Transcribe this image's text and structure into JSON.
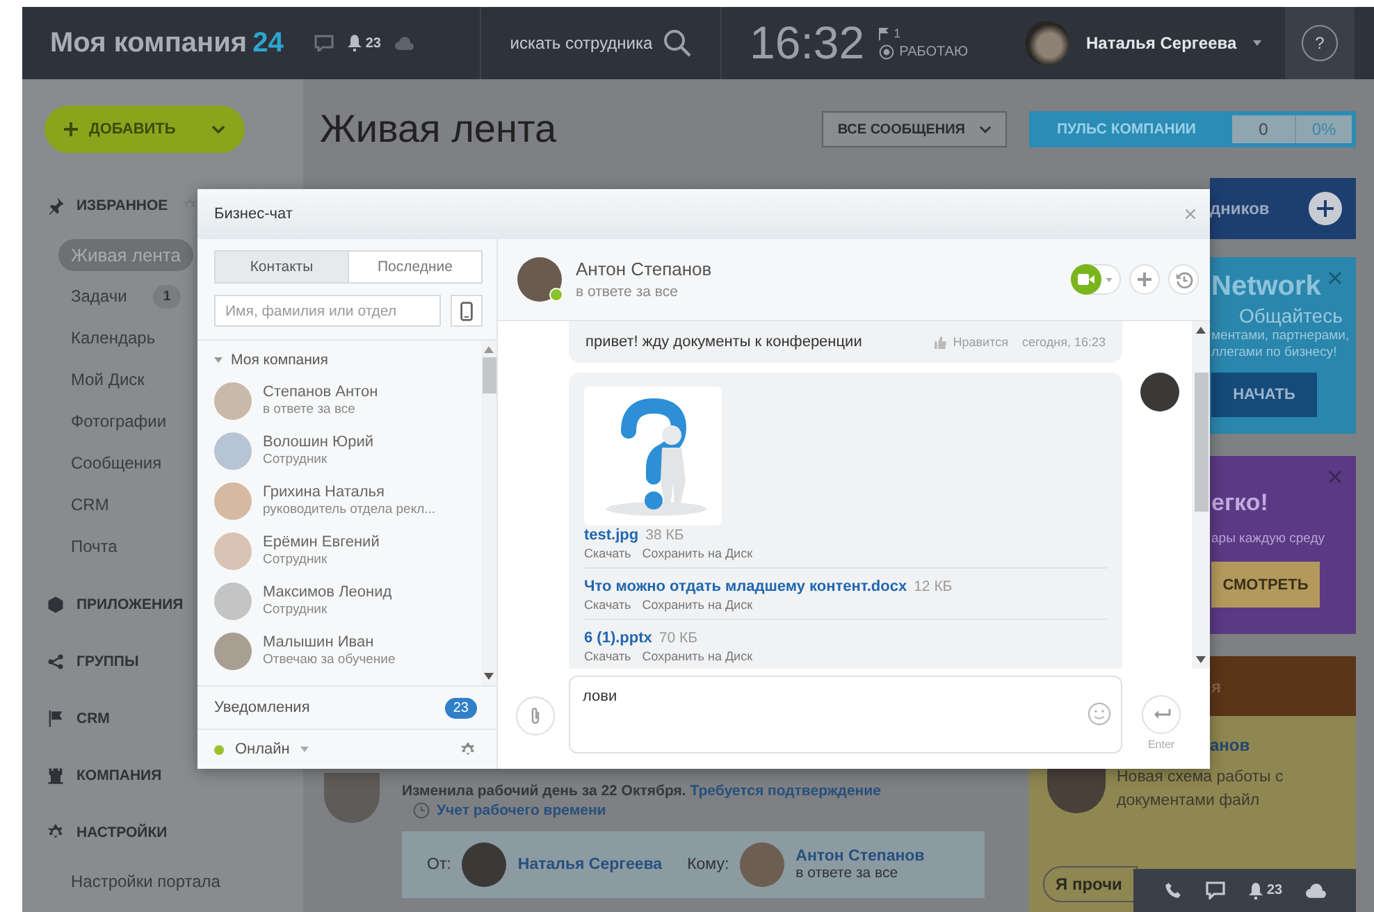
{
  "top_bar": {
    "company": "Моя компания",
    "company_suffix": "24",
    "notifications": "23",
    "search_label": "искать сотрудника",
    "time": "16:32",
    "flag_count": "1",
    "work_status": "РАБОТАЮ",
    "user_name": "Наталья Сергеева",
    "help": "?"
  },
  "add_button": "ДОБАВИТЬ",
  "sidebar": [
    {
      "kind": "section",
      "label": "ИЗБРАННОЕ"
    },
    {
      "kind": "link",
      "label": "Живая лента",
      "selected": true
    },
    {
      "kind": "link",
      "label": "Задачи",
      "selected": false,
      "badge": "1"
    },
    {
      "kind": "link",
      "label": "Календарь",
      "selected": false
    },
    {
      "kind": "link",
      "label": "Мой Диск",
      "selected": false
    },
    {
      "kind": "link",
      "label": "Фотографии",
      "selected": false
    },
    {
      "kind": "link",
      "label": "Сообщения",
      "selected": false
    },
    {
      "kind": "link",
      "label": "CRM",
      "selected": false
    },
    {
      "kind": "link",
      "label": "Почта",
      "selected": false
    },
    {
      "kind": "section",
      "label": "ПРИЛОЖЕНИЯ"
    },
    {
      "kind": "section",
      "label": "ГРУППЫ"
    },
    {
      "kind": "section",
      "label": "CRM"
    },
    {
      "kind": "section",
      "label": "КОМПАНИЯ"
    },
    {
      "kind": "section",
      "label": "НАСТРОЙКИ"
    },
    {
      "kind": "link",
      "label": "Настройки портала",
      "selected": false
    }
  ],
  "page_title": "Живая лента",
  "filter_button": "ВСЕ СООБЩЕНИЯ",
  "pulse": {
    "label": "ПУЛЬС КОМПАНИИ",
    "count": "0",
    "percent": "0%"
  },
  "widgets": [
    {
      "kind": "banner",
      "text": "дников"
    },
    {
      "kind": "promo",
      "title": "Network",
      "lines": [
        "Общайтесь",
        "ментами, партнерами,",
        "ллегами по бизнесу!"
      ],
      "button": "НАЧАТЬ"
    },
    {
      "kind": "promo",
      "title": "егко!",
      "lines": [
        "ары каждую среду"
      ],
      "button": "СМОТРЕТЬ"
    },
    {
      "kind": "post",
      "header": "я",
      "author": "анов",
      "text": "Новая схема работы с документами файл",
      "button": "Я прочи"
    }
  ],
  "feed_entry": {
    "text": "Изменила рабочий день за 22 Октября.",
    "link": "Требуется подтверждение",
    "category": "Учет рабочего времени",
    "from_label": "От:",
    "from": "Наталья Сергеева",
    "to_label": "Кому:",
    "to": "Антон Степанов",
    "to_status": "в ответе за все"
  },
  "dock": {
    "notifications": "23"
  },
  "chat": {
    "title": "Бизнес-чат",
    "tabs": [
      {
        "label": "Контакты",
        "selected": true
      },
      {
        "label": "Последние",
        "selected": false
      }
    ],
    "search": {
      "placeholder": "Имя, фамилия или отдел"
    },
    "group": {
      "label": "Моя компания",
      "expanded": true
    },
    "contacts": [
      {
        "name": "Степанов Антон",
        "role": "в ответе за все"
      },
      {
        "name": "Волошин Юрий",
        "role": "Сотрудник"
      },
      {
        "name": "Грихина Наталья",
        "role": "руководитель отдела рекл..."
      },
      {
        "name": "Ерёмин Евгений",
        "role": "Сотрудник"
      },
      {
        "name": "Максимов Леонид",
        "role": "Сотрудник"
      },
      {
        "name": "Малышин Иван",
        "role": "Отвечаю за обучение"
      }
    ],
    "notifications": {
      "label": "Уведомления",
      "count": "23"
    },
    "status": {
      "label": "Онлайн",
      "online": true
    },
    "partner": {
      "name": "Антон Степанов",
      "status": "в ответе за все",
      "online": true
    },
    "messages": [
      {
        "kind": "text",
        "text": "привет! жду документы к конференции",
        "like": "Нравится",
        "time": "сегодня, 16:23"
      },
      {
        "kind": "files",
        "files": [
          {
            "name": "test.jpg",
            "size": "38 КБ",
            "preview": true,
            "actions": [
              "Скачать",
              "Сохранить на Диск"
            ]
          },
          {
            "name": "Что можно отдать младшему контент.docx",
            "size": "12 КБ",
            "preview": false,
            "actions": [
              "Скачать",
              "Сохранить на Диск"
            ]
          },
          {
            "name": "6 (1).pptx",
            "size": "70 КБ",
            "preview": false,
            "actions": [
              "Скачать",
              "Сохранить на Диск"
            ]
          }
        ]
      }
    ],
    "input": {
      "value": "лови"
    },
    "send_hint": "Enter"
  }
}
